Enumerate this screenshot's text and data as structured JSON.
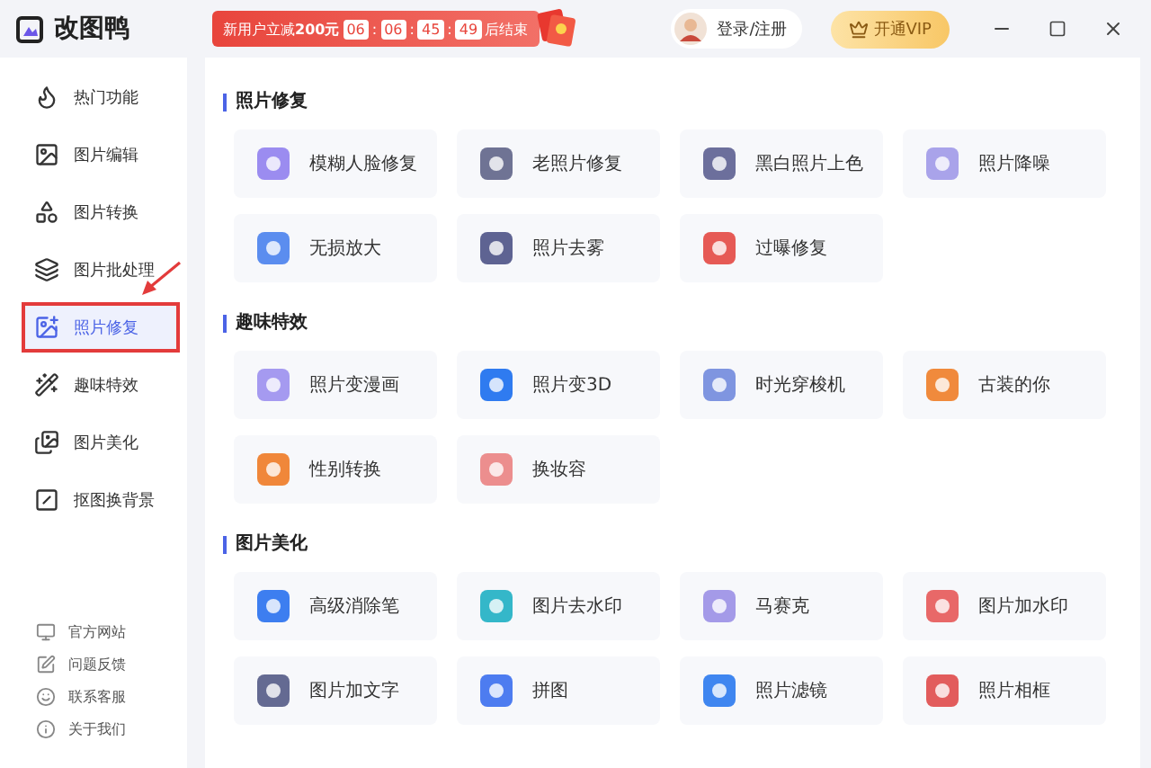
{
  "app": {
    "name": "改图鸭"
  },
  "promo": {
    "text": "新用户立减**200元**",
    "countdown": [
      "06",
      "06",
      "45",
      "49"
    ],
    "separator": ":",
    "suffix": "后结束"
  },
  "account": {
    "login": "登录/注册",
    "vip_button": "开通VIP"
  },
  "sidebar": {
    "items": [
      {
        "label": "热门功能",
        "selected": false,
        "highlighted": false
      },
      {
        "label": "图片编辑",
        "selected": false,
        "highlighted": false
      },
      {
        "label": "图片转换",
        "selected": false,
        "highlighted": false
      },
      {
        "label": "图片批处理",
        "selected": false,
        "highlighted": false
      },
      {
        "label": "照片修复",
        "selected": true,
        "highlighted": true
      },
      {
        "label": "趣味特效",
        "selected": false,
        "highlighted": false
      },
      {
        "label": "图片美化",
        "selected": false,
        "highlighted": false
      },
      {
        "label": "抠图换背景",
        "selected": false,
        "highlighted": false
      }
    ],
    "links": [
      "官方网站",
      "问题反馈",
      "联系客服",
      "关于我们"
    ]
  },
  "sections": [
    {
      "title": "照片修复",
      "tools": [
        {
          "label": "模糊人脸修复",
          "color": "#9b8cf0"
        },
        {
          "label": "老照片修复",
          "color": "#6f7394"
        },
        {
          "label": "黑白照片上色",
          "color": "#6c6f9c"
        },
        {
          "label": "照片降噪",
          "color": "#a9a3ea"
        },
        {
          "label": "无损放大",
          "color": "#5b8def"
        },
        {
          "label": "照片去雾",
          "color": "#5e6392"
        },
        {
          "label": "过曝修复",
          "color": "#e65a55"
        }
      ]
    },
    {
      "title": "趣味特效",
      "tools": [
        {
          "label": "照片变漫画",
          "color": "#a59af0"
        },
        {
          "label": "照片变3D",
          "color": "#2f7bf0"
        },
        {
          "label": "时光穿梭机",
          "color": "#7f95e0"
        },
        {
          "label": "古装的你",
          "color": "#f08a3c"
        },
        {
          "label": "性别转换",
          "color": "#f0873a"
        },
        {
          "label": "换妆容",
          "color": "#ec8e8e"
        }
      ]
    },
    {
      "title": "图片美化",
      "tools": [
        {
          "label": "高级消除笔",
          "color": "#3d7ef0"
        },
        {
          "label": "图片去水印",
          "color": "#34b7c9"
        },
        {
          "label": "马赛克",
          "color": "#a49ae8"
        },
        {
          "label": "图片加水印",
          "color": "#e86868"
        },
        {
          "label": "图片加文字",
          "color": "#646a92"
        },
        {
          "label": "拼图",
          "color": "#4d7cf0"
        },
        {
          "label": "照片滤镜",
          "color": "#3f86f0"
        },
        {
          "label": "照片相框",
          "color": "#e25c5c"
        }
      ]
    }
  ]
}
